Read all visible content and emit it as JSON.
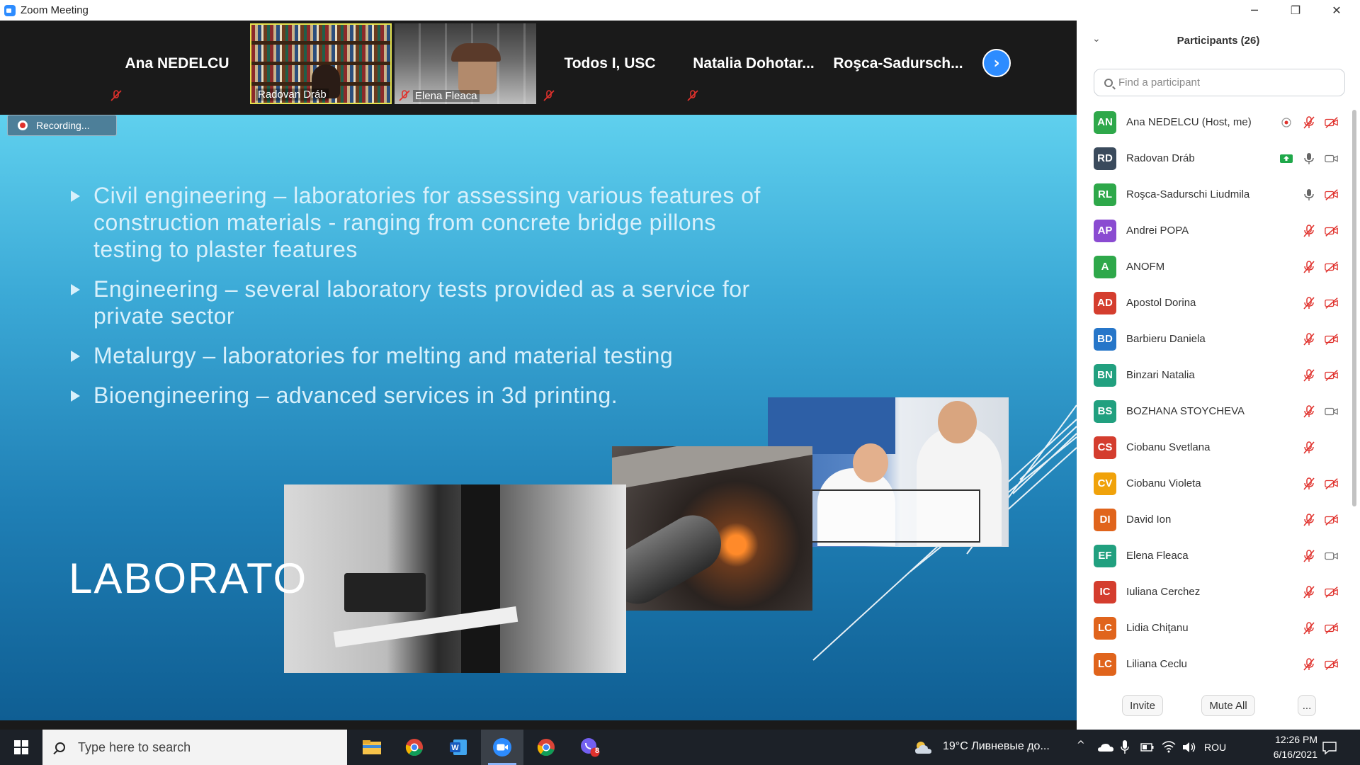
{
  "window": {
    "title": "Zoom Meeting",
    "minimize": "─",
    "restore": "❐",
    "close": "✕"
  },
  "gallery": {
    "tiles": [
      {
        "name": "Ana NEDELCU",
        "video": false,
        "muted": true
      },
      {
        "name": "Radovan Dráb",
        "video": true,
        "muted": false,
        "active_speaker": true
      },
      {
        "name": "Elena Fleaca",
        "video": true,
        "muted": true
      },
      {
        "name": "Todos I, USC",
        "video": false,
        "muted": true
      },
      {
        "name": "Natalia  Dohotar...",
        "video": false,
        "muted": true
      },
      {
        "name": "Roşca-Sadursch...",
        "video": false,
        "muted": false
      }
    ],
    "next_icon": "›"
  },
  "recording": {
    "label": "Recording..."
  },
  "slide": {
    "bullets": [
      "Civil engineering – laboratories for assessing various features of construction materials - ranging from concrete bridge pillons testing to plaster features",
      "Engineering – several laboratory tests provided as a service for private sector",
      "Metalurgy – laboratories for melting and material testing",
      "Bioengineering – advanced services in 3d printing."
    ],
    "title": "LABORATO"
  },
  "participants": {
    "header": "Participants (26)",
    "search_placeholder": "Find a participant",
    "list": [
      {
        "initials": "AN",
        "name": "Ana NEDELCU (Host, me)",
        "color": "#2ea84a",
        "mic": "off",
        "cam": "off",
        "extra": "record-icon"
      },
      {
        "initials": "RD",
        "name": "Radovan Dráb",
        "color": "#3a4a5c",
        "mic": "on",
        "cam": "on",
        "extra": "share-icon"
      },
      {
        "initials": "RL",
        "name": "Roşca-Sadurschi Liudmila",
        "color": "#2ea84a",
        "mic": "on",
        "cam": "off"
      },
      {
        "initials": "AP",
        "name": "Andrei POPA",
        "color": "#8a4bd1",
        "mic": "off",
        "cam": "off"
      },
      {
        "initials": "A",
        "name": "ANOFM",
        "color": "#2ea84a",
        "mic": "off",
        "cam": "off"
      },
      {
        "initials": "AD",
        "name": "Apostol Dorina",
        "color": "#d43d2e",
        "mic": "off",
        "cam": "off"
      },
      {
        "initials": "BD",
        "name": "Barbieru Daniela",
        "color": "#2676c9",
        "mic": "off",
        "cam": "off"
      },
      {
        "initials": "BN",
        "name": "Binzari Natalia",
        "color": "#21a07f",
        "mic": "off",
        "cam": "off"
      },
      {
        "initials": "BS",
        "name": "BOZHANA STOYCHEVA",
        "color": "#21a07f",
        "mic": "off",
        "cam": "on"
      },
      {
        "initials": "CS",
        "name": "Ciobanu Svetlana",
        "color": "#d43d2e",
        "mic": "off",
        "cam": "none"
      },
      {
        "initials": "CV",
        "name": "Ciobanu Violeta",
        "color": "#f0a20a",
        "mic": "off",
        "cam": "off"
      },
      {
        "initials": "DI",
        "name": "David Ion",
        "color": "#e0641c",
        "mic": "off",
        "cam": "off"
      },
      {
        "initials": "EF",
        "name": "Elena Fleaca",
        "color": "#21a07f",
        "mic": "off",
        "cam": "on"
      },
      {
        "initials": "IC",
        "name": "Iuliana Cerchez",
        "color": "#d43d2e",
        "mic": "off",
        "cam": "off"
      },
      {
        "initials": "LC",
        "name": "Lidia Chiţanu",
        "color": "#e0641c",
        "mic": "off",
        "cam": "off"
      },
      {
        "initials": "LC",
        "name": "Liliana Ceclu",
        "color": "#e0641c",
        "mic": "off",
        "cam": "off"
      }
    ],
    "footer": {
      "invite": "Invite",
      "mute_all": "Mute All",
      "more": "..."
    }
  },
  "taskbar": {
    "search_placeholder": "Type here to search",
    "apps": [
      "file-explorer-icon",
      "chrome-icon",
      "word-icon",
      "zoom-icon",
      "chrome-icon",
      "viber-icon"
    ],
    "viber_badge": "8",
    "weather": "19°C  Ливневые до...",
    "language": "ROU",
    "time": "12:26 PM",
    "date": "6/16/2021"
  },
  "colors": {
    "accent": "#2d8cff",
    "muted_red": "#e0312c",
    "slide_text": "#d8f0fb"
  }
}
